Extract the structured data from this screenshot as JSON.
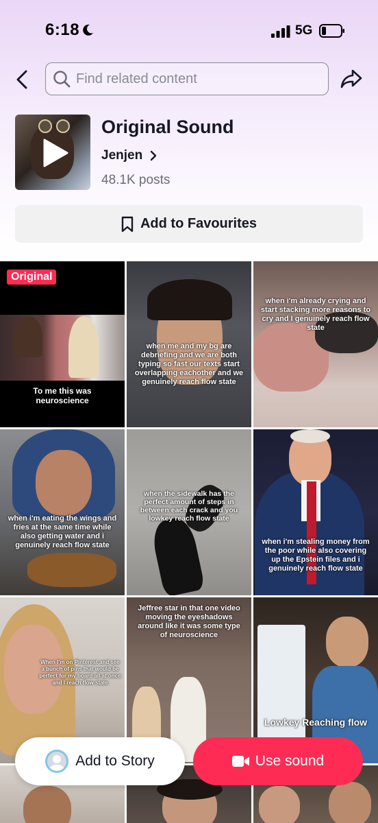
{
  "status_bar": {
    "time": "6:18",
    "network": "5G"
  },
  "search": {
    "placeholder": "Find related content"
  },
  "sound": {
    "title": "Original Sound",
    "author": "Jenjen",
    "posts": "48.1K posts"
  },
  "favourite_button": {
    "label": "Add to Favourites"
  },
  "grid": {
    "badge": "Original",
    "captions": [
      "To me this was neuroscience",
      "when me and my bg are debriefing and we are both typing so fast our texts start overlapping eachother and we genuinely reach flow state",
      "when i'm already crying and start stacking more reasons to cry and I genuinely reach flow state",
      "when i'm eating the wings and fries at the same time while also getting water and i genuinely reach flow state",
      "when the sidewalk has the perfect amount of steps in between each crack and you lowkey reach flow state",
      "when i'm stealing money from the poor while also covering up the Epstein files and i genuinely reach flow state",
      "When I'm on Pinterest and see a bunch of pins that would be perfect for my board all at once and I reach flow state",
      "Jeffree star in that one video moving the eyeshadows around like it was some type of neuroscience",
      "Lowkey Reaching flow"
    ]
  },
  "bottom_actions": {
    "add_story": "Add to Story",
    "use_sound": "Use sound"
  },
  "colors": {
    "accent": "#fe2c55",
    "text": "#161823",
    "muted": "#6c6d74"
  },
  "icons": [
    "moon-icon",
    "signal-icon",
    "battery-icon",
    "back-arrow-icon",
    "search-icon",
    "share-icon",
    "play-icon",
    "chevron-right-icon",
    "bookmark-icon",
    "avatar-icon",
    "video-camera-icon"
  ]
}
